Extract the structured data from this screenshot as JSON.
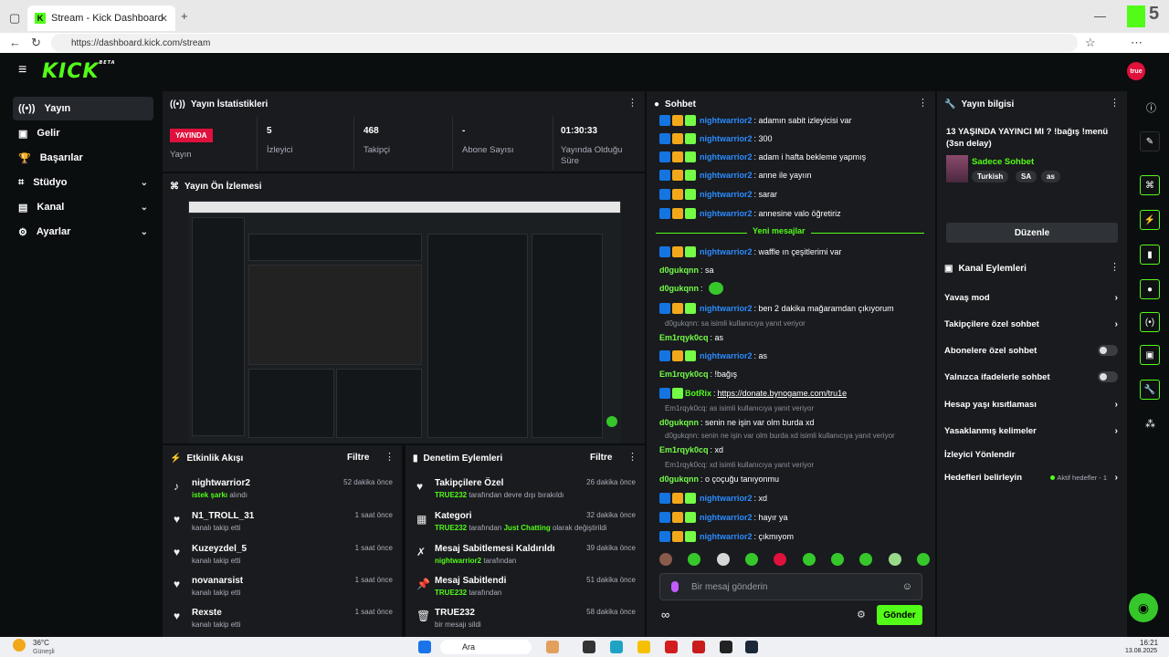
{
  "browser": {
    "tab_title": "Stream - Kick Dashboard",
    "url": "https://dashboard.kick.com/stream"
  },
  "header": {
    "logo": "KICK",
    "logo_beta": "BETA",
    "avatar_text": "true"
  },
  "sidebar": {
    "items": [
      {
        "label": "Yayın",
        "icon": "broadcast-icon"
      },
      {
        "label": "Gelir",
        "icon": "money-icon"
      },
      {
        "label": "Başarılar",
        "icon": "trophy-icon"
      },
      {
        "label": "Stüdyo",
        "icon": "studio-icon"
      },
      {
        "label": "Kanal",
        "icon": "channel-icon"
      },
      {
        "label": "Ayarlar",
        "icon": "gear-icon"
      }
    ]
  },
  "stats": {
    "title": "Yayın İstatistikleri",
    "live_badge": "YAYINDA",
    "live_label": "Yayın",
    "viewers_value": "5",
    "viewers_label": "İzleyici",
    "followers_value": "468",
    "followers_label": "Takipçi",
    "subs_value": "-",
    "subs_label": "Abone Sayısı",
    "uptime_value": "01:30:33",
    "uptime_label": "Yayında Olduğu Süre"
  },
  "preview": {
    "title": "Yayın Ön İzlemesi"
  },
  "activity": {
    "title": "Etkinlik Akışı",
    "filter": "Filtre",
    "rows": [
      {
        "name": "nightwarrior2",
        "sub_green": "istek şarkı",
        "sub": " alındı",
        "time": "52 dakika önce"
      },
      {
        "name": "N1_TROLL_31",
        "sub_green": "",
        "sub": "kanalı takip etti",
        "time": "1 saat önce"
      },
      {
        "name": "Kuzeyzdel_5",
        "sub_green": "",
        "sub": "kanalı takip etti",
        "time": "1 saat önce"
      },
      {
        "name": "novanarsist",
        "sub_green": "",
        "sub": "kanalı takip etti",
        "time": "1 saat önce"
      },
      {
        "name": "Rexste",
        "sub_green": "",
        "sub": "kanalı takip etti",
        "time": "1 saat önce"
      }
    ]
  },
  "moderation": {
    "title": "Denetim Eylemleri",
    "filter": "Filtre",
    "rows": [
      {
        "title": "Takipçilere Özel",
        "green": "TRUE232",
        "rest": " tarafından devre dışı bırakıldı",
        "time": "26 dakika önce"
      },
      {
        "title": "Kategori",
        "green": "TRUE232",
        "rest": " tarafından ",
        "green2": "Just Chatting",
        "rest2": " olarak değiştirildi",
        "time": "32 dakika önce"
      },
      {
        "title": "Mesaj Sabitlemesi Kaldırıldı",
        "green": "nightwarrior2",
        "rest": " tarafından",
        "time": "39 dakika önce"
      },
      {
        "title": "Mesaj Sabitlendi",
        "green": "TRUE232",
        "rest": " tarafından",
        "time": "51 dakika önce"
      },
      {
        "title": "TRUE232",
        "green": "",
        "rest": "bir mesajı sildi",
        "time": "58 dakika önce"
      }
    ]
  },
  "chat": {
    "title": "Sohbet",
    "new_messages": "Yeni mesajlar",
    "placeholder": "Bir mesaj gönderin",
    "send": "Gönder",
    "messages": [
      {
        "user": "nightwarrior2",
        "text": ": adamın sabit izleyicisi var"
      },
      {
        "user": "nightwarrior2",
        "text": ": 300"
      },
      {
        "user": "nightwarrior2",
        "text": ": adam i hafta bekleme yapmış"
      },
      {
        "user": "nightwarrior2",
        "text": ": anne ile yayıın"
      },
      {
        "user": "nightwarrior2",
        "text": ": sarar"
      },
      {
        "user": "nightwarrior2",
        "text": ": annesine valo öğretiriz"
      },
      {
        "user": "nightwarrior2",
        "text": ": waffle ın çeşitlerimi var"
      },
      {
        "user": "d0gukqnn",
        "text": ": sa"
      },
      {
        "user": "d0gukqnn",
        "text": ":"
      },
      {
        "user": "nightwarrior2",
        "text": ": ben 2 dakika mağaramdan çıkıyorum"
      },
      {
        "reply": "d0gukqnn: sa isimli kullanıcıya yanıt veriyor"
      },
      {
        "user": "Em1rqyk0cq",
        "text": ": as"
      },
      {
        "user": "nightwarrior2",
        "text": ": as"
      },
      {
        "user": "Em1rqyk0cq",
        "text": ": !bağış"
      },
      {
        "user": "BotRix",
        "text": ": ",
        "link": "https://donate.bynogame.com/tru1e"
      },
      {
        "reply": "Em1rqyk0cq: as isimli kullanıcıya yanıt veriyor"
      },
      {
        "user": "d0gukqnn",
        "text": ": senin ne işin var olm burda xd"
      },
      {
        "reply": "d0gukqnn: senin ne işin var olm burda xd isimli kullanıcıya yanıt veriyor"
      },
      {
        "user": "Em1rqyk0cq",
        "text": ": xd"
      },
      {
        "reply": "Em1rqyk0cq: xd isimli kullanıcıya yanıt veriyor"
      },
      {
        "user": "d0gukqnn",
        "text": ": o çoçuğu tanıyonmu"
      },
      {
        "user": "nightwarrior2",
        "text": ": xd"
      },
      {
        "user": "nightwarrior2",
        "text": ": hayır ya"
      },
      {
        "user": "nightwarrior2",
        "text": ": çıkmıyom"
      }
    ]
  },
  "stream_info": {
    "title": "Yayın bilgisi",
    "stream_title": "13 YAŞINDA YAYINCI MI ? !bağış !menü (3sn delay)",
    "category": "Sadece Sohbet",
    "tags": [
      "Turkish",
      "SA",
      "as"
    ],
    "edit": "Düzenle"
  },
  "channel_actions": {
    "title": "Kanal Eylemleri",
    "rows": [
      {
        "label": "Yavaş mod",
        "kind": "chevron"
      },
      {
        "label": "Takipçilere özel sohbet",
        "kind": "chevron"
      },
      {
        "label": "Abonelere özel sohbet",
        "kind": "toggle"
      },
      {
        "label": "Yalnızca ifadelerle sohbet",
        "kind": "toggle"
      },
      {
        "label": "Hesap yaşı kısıtlaması",
        "kind": "chevron"
      },
      {
        "label": "Yasaklanmış kelimeler",
        "kind": "chevron"
      },
      {
        "label": "İzleyici Yönlendir",
        "kind": "none"
      },
      {
        "label": "Hedefleri belirleyin",
        "kind": "chevron",
        "extra": "Aktif hedefler - 1"
      }
    ]
  },
  "taskbar": {
    "weather_temp": "36°C",
    "weather_desc": "Güneşli",
    "search": "Ara",
    "time": "16:21",
    "date": "13.08.2025"
  },
  "colors": {
    "accent": "#53fc18",
    "live": "#e0113c",
    "panel": "#191b1f"
  }
}
